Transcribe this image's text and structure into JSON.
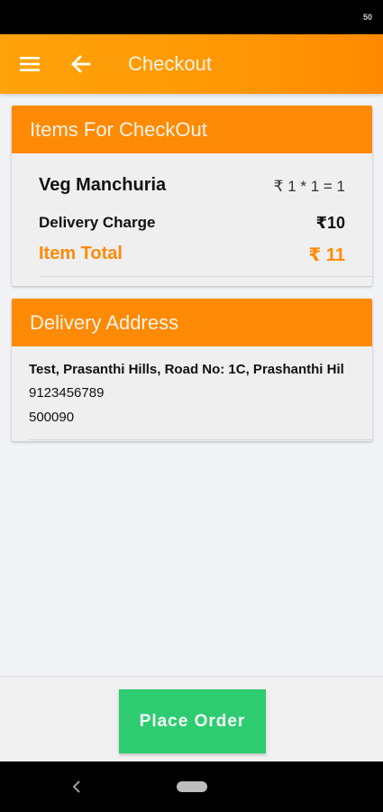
{
  "status_bar": {
    "clock": "50"
  },
  "app_bar": {
    "title": "Checkout",
    "menu_icon": "menu-icon",
    "back_icon": "back-arrow-icon"
  },
  "checkout_card": {
    "header": "Items For CheckOut",
    "item": {
      "name": "Veg Manchuria",
      "calc": "₹ 1 * 1 = 1"
    },
    "delivery": {
      "label": "Delivery Charge",
      "value": "₹10"
    },
    "total": {
      "label": "Item Total",
      "value": "₹ 11"
    }
  },
  "address_card": {
    "header": "Delivery Address",
    "street": "Test, Prasanthi Hills, Road No: 1C, Prashanthi Hil",
    "phone": "9123456789",
    "pincode": "500090"
  },
  "footer": {
    "place_order_label": "Place Order"
  },
  "colors": {
    "accent": "#ff8a05",
    "button": "#2ecc71"
  }
}
